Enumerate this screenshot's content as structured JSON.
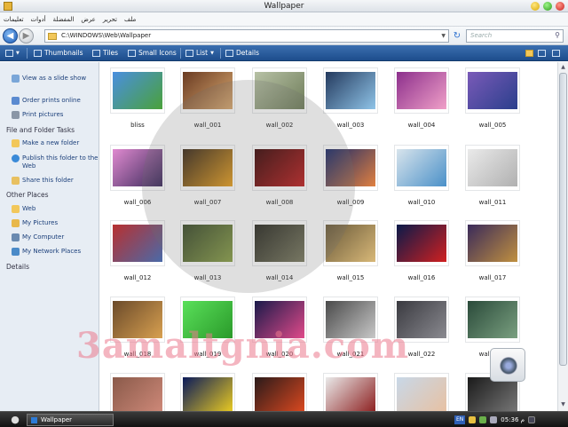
{
  "window": {
    "title": "Wallpaper",
    "menu": [
      "ملف",
      "تحرير",
      "عرض",
      "المفضلة",
      "أدوات",
      "تعليمات"
    ]
  },
  "address": {
    "path": "C:\\WINDOWS\\Web\\Wallpaper",
    "search_placeholder": "Search"
  },
  "toolbar": {
    "views": [
      "Thumbnails",
      "Tiles",
      "Small Icons",
      "List",
      "Details"
    ]
  },
  "sidebar": {
    "picture_tasks": [
      {
        "label": "View as a slide show",
        "icon": "slideshow-icon"
      },
      {
        "label": "Order prints online",
        "icon": "prints-icon"
      },
      {
        "label": "Print pictures",
        "icon": "printer-icon"
      }
    ],
    "file_folder_heading": "File and Folder Tasks",
    "file_folder_tasks": [
      {
        "label": "Make a new folder",
        "icon": "new-folder-icon"
      },
      {
        "label": "Publish this folder to the Web",
        "icon": "publish-web-icon"
      },
      {
        "label": "Share this folder",
        "icon": "share-icon"
      }
    ],
    "other_places_heading": "Other Places",
    "other_places": [
      {
        "label": "Web",
        "icon": "folder-icon"
      },
      {
        "label": "My Pictures",
        "icon": "my-pictures-icon"
      },
      {
        "label": "My Computer",
        "icon": "computer-icon"
      },
      {
        "label": "My Network Places",
        "icon": "network-icon"
      }
    ],
    "details_heading": "Details"
  },
  "files": [
    {
      "name": "bliss",
      "colors": [
        "#4a8fe0",
        "#4aa13a"
      ]
    },
    {
      "name": "wall_001",
      "colors": [
        "#6a3b22",
        "#d8a870"
      ]
    },
    {
      "name": "wall_002",
      "colors": [
        "#b7c1a5",
        "#6f7d5a"
      ]
    },
    {
      "name": "wall_003",
      "colors": [
        "#243a5e",
        "#8fc4e8"
      ]
    },
    {
      "name": "wall_004",
      "colors": [
        "#8c2f8c",
        "#f0a0c8"
      ]
    },
    {
      "name": "wall_005",
      "colors": [
        "#7a5ab8",
        "#2a3f8c"
      ]
    },
    {
      "name": "wall_006",
      "colors": [
        "#e08ad0",
        "#3a2a5a"
      ]
    },
    {
      "name": "wall_007",
      "colors": [
        "#3a2a1a",
        "#e8a020"
      ]
    },
    {
      "name": "wall_008",
      "colors": [
        "#3a0808",
        "#c02020"
      ]
    },
    {
      "name": "wall_009",
      "colors": [
        "#1a2a6a",
        "#e08040"
      ]
    },
    {
      "name": "wall_010",
      "colors": [
        "#d8e4ec",
        "#4a90c8"
      ]
    },
    {
      "name": "wall_011",
      "colors": [
        "#eaeaea",
        "#b0b0b0"
      ]
    },
    {
      "name": "wall_012",
      "colors": [
        "#b83030",
        "#4a6aa8"
      ]
    },
    {
      "name": "wall_013",
      "colors": [
        "#3a4a2a",
        "#8aa048"
      ]
    },
    {
      "name": "wall_014",
      "colors": [
        "#2a2a22",
        "#7a7a60"
      ]
    },
    {
      "name": "wall_015",
      "colors": [
        "#6a5a3a",
        "#d8b878"
      ]
    },
    {
      "name": "wall_016",
      "colors": [
        "#0a1a4a",
        "#d02020"
      ]
    },
    {
      "name": "wall_017",
      "colors": [
        "#3a2a5a",
        "#c09040"
      ]
    },
    {
      "name": "wall_018",
      "colors": [
        "#6a4a2a",
        "#d8a050"
      ]
    },
    {
      "name": "wall_019",
      "colors": [
        "#5ae05a",
        "#2a9a2a"
      ]
    },
    {
      "name": "wall_020",
      "colors": [
        "#1a1a4a",
        "#e04a8a"
      ]
    },
    {
      "name": "wall_021",
      "colors": [
        "#4a4a4a",
        "#c8c8c8"
      ]
    },
    {
      "name": "wall_022",
      "colors": [
        "#3a3a40",
        "#8a8a90"
      ]
    },
    {
      "name": "wall_023",
      "colors": [
        "#2a4a3a",
        "#7aa080"
      ]
    },
    {
      "name": "",
      "colors": [
        "#8a5a4a",
        "#d08a7a"
      ]
    },
    {
      "name": "",
      "colors": [
        "#0a1a5a",
        "#f0d020"
      ]
    },
    {
      "name": "",
      "colors": [
        "#2a1a1a",
        "#e04a20"
      ]
    },
    {
      "name": "",
      "colors": [
        "#eaeaea",
        "#8a1a1a"
      ]
    },
    {
      "name": "",
      "colors": [
        "#c8d8e8",
        "#e8c0a0"
      ]
    },
    {
      "name": "",
      "colors": [
        "#1a1a1a",
        "#7a7a7a"
      ]
    }
  ],
  "watermark": {
    "site": "3amaltgnia.com"
  },
  "taskbar": {
    "task": "Wallpaper",
    "lang": "EN",
    "clock": "05:36 م"
  },
  "theme": {
    "toolbar": "#2a5c9c",
    "sidebar": "#e7edf4",
    "link": "#1b3f7a"
  }
}
